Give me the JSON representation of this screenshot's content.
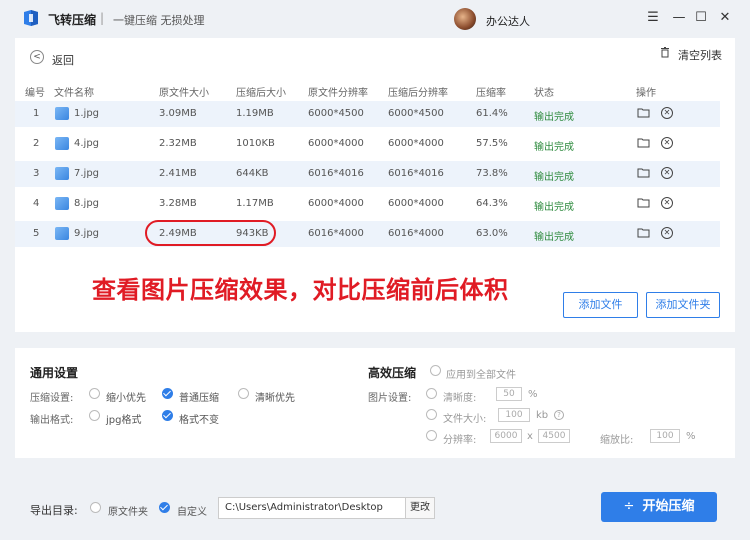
{
  "app": {
    "name": "飞转压缩",
    "separator": "|",
    "subtitle": "一键压缩 无损处理",
    "username": "办公达人"
  },
  "window": {
    "minimize": "—",
    "maximize": "☐",
    "close": "✕",
    "menu": "☰"
  },
  "toolbar": {
    "back_label": "返回",
    "clear_label": "清空列表"
  },
  "table": {
    "headers": [
      "编号",
      "文件名称",
      "原文件大小",
      "压缩后大小",
      "原文件分辨率",
      "压缩后分辨率",
      "压缩率",
      "状态",
      "操作"
    ],
    "rows": [
      {
        "no": "1",
        "name": "1.jpg",
        "orig": "3.09MB",
        "comp": "1.19MB",
        "orig_res": "6000*4500",
        "comp_res": "6000*4500",
        "rate": "61.4%",
        "status": "输出完成"
      },
      {
        "no": "2",
        "name": "4.jpg",
        "orig": "2.32MB",
        "comp": "1010KB",
        "orig_res": "6000*4000",
        "comp_res": "6000*4000",
        "rate": "57.5%",
        "status": "输出完成"
      },
      {
        "no": "3",
        "name": "7.jpg",
        "orig": "2.41MB",
        "comp": "644KB",
        "orig_res": "6016*4016",
        "comp_res": "6016*4016",
        "rate": "73.8%",
        "status": "输出完成"
      },
      {
        "no": "4",
        "name": "8.jpg",
        "orig": "3.28MB",
        "comp": "1.17MB",
        "orig_res": "6000*4000",
        "comp_res": "6000*4000",
        "rate": "64.3%",
        "status": "输出完成"
      },
      {
        "no": "5",
        "name": "9.jpg",
        "orig": "2.49MB",
        "comp": "943KB",
        "orig_res": "6016*4000",
        "comp_res": "6016*4000",
        "rate": "63.0%",
        "status": "输出完成"
      }
    ]
  },
  "caption": "查看图片压缩效果，对比压缩前后体积",
  "buttons": {
    "add_file": "添加文件",
    "add_folder": "添加文件夹",
    "start": "开始压缩",
    "change": "更改"
  },
  "general": {
    "title": "通用设置",
    "compress_label": "压缩设置:",
    "compress_options": [
      "缩小优先",
      "普通压缩",
      "清晰优先"
    ],
    "format_label": "输出格式:",
    "format_options": [
      "jpg格式",
      "格式不变"
    ]
  },
  "advanced": {
    "title": "高效压缩",
    "apply_all": "应用到全部文件",
    "image_label": "图片设置:",
    "clarity_label": "清晰度:",
    "clarity_value": "50",
    "percent": "%",
    "filesize_label": "文件大小:",
    "filesize_value": "100",
    "filesize_unit": "kb",
    "resolution_label": "分辨率:",
    "res_w": "6000",
    "res_x": "x",
    "res_h": "4500",
    "scale_label": "缩放比:",
    "scale_value": "100",
    "scale_unit": "%"
  },
  "output": {
    "label": "导出目录:",
    "option_orig": "原文件夹",
    "option_custom": "自定义",
    "path": "C:\\Users\\Administrator\\Desktop"
  },
  "colors": {
    "accent": "#2f7ee8",
    "success": "#2e8b3e",
    "highlight": "#e01b24"
  }
}
